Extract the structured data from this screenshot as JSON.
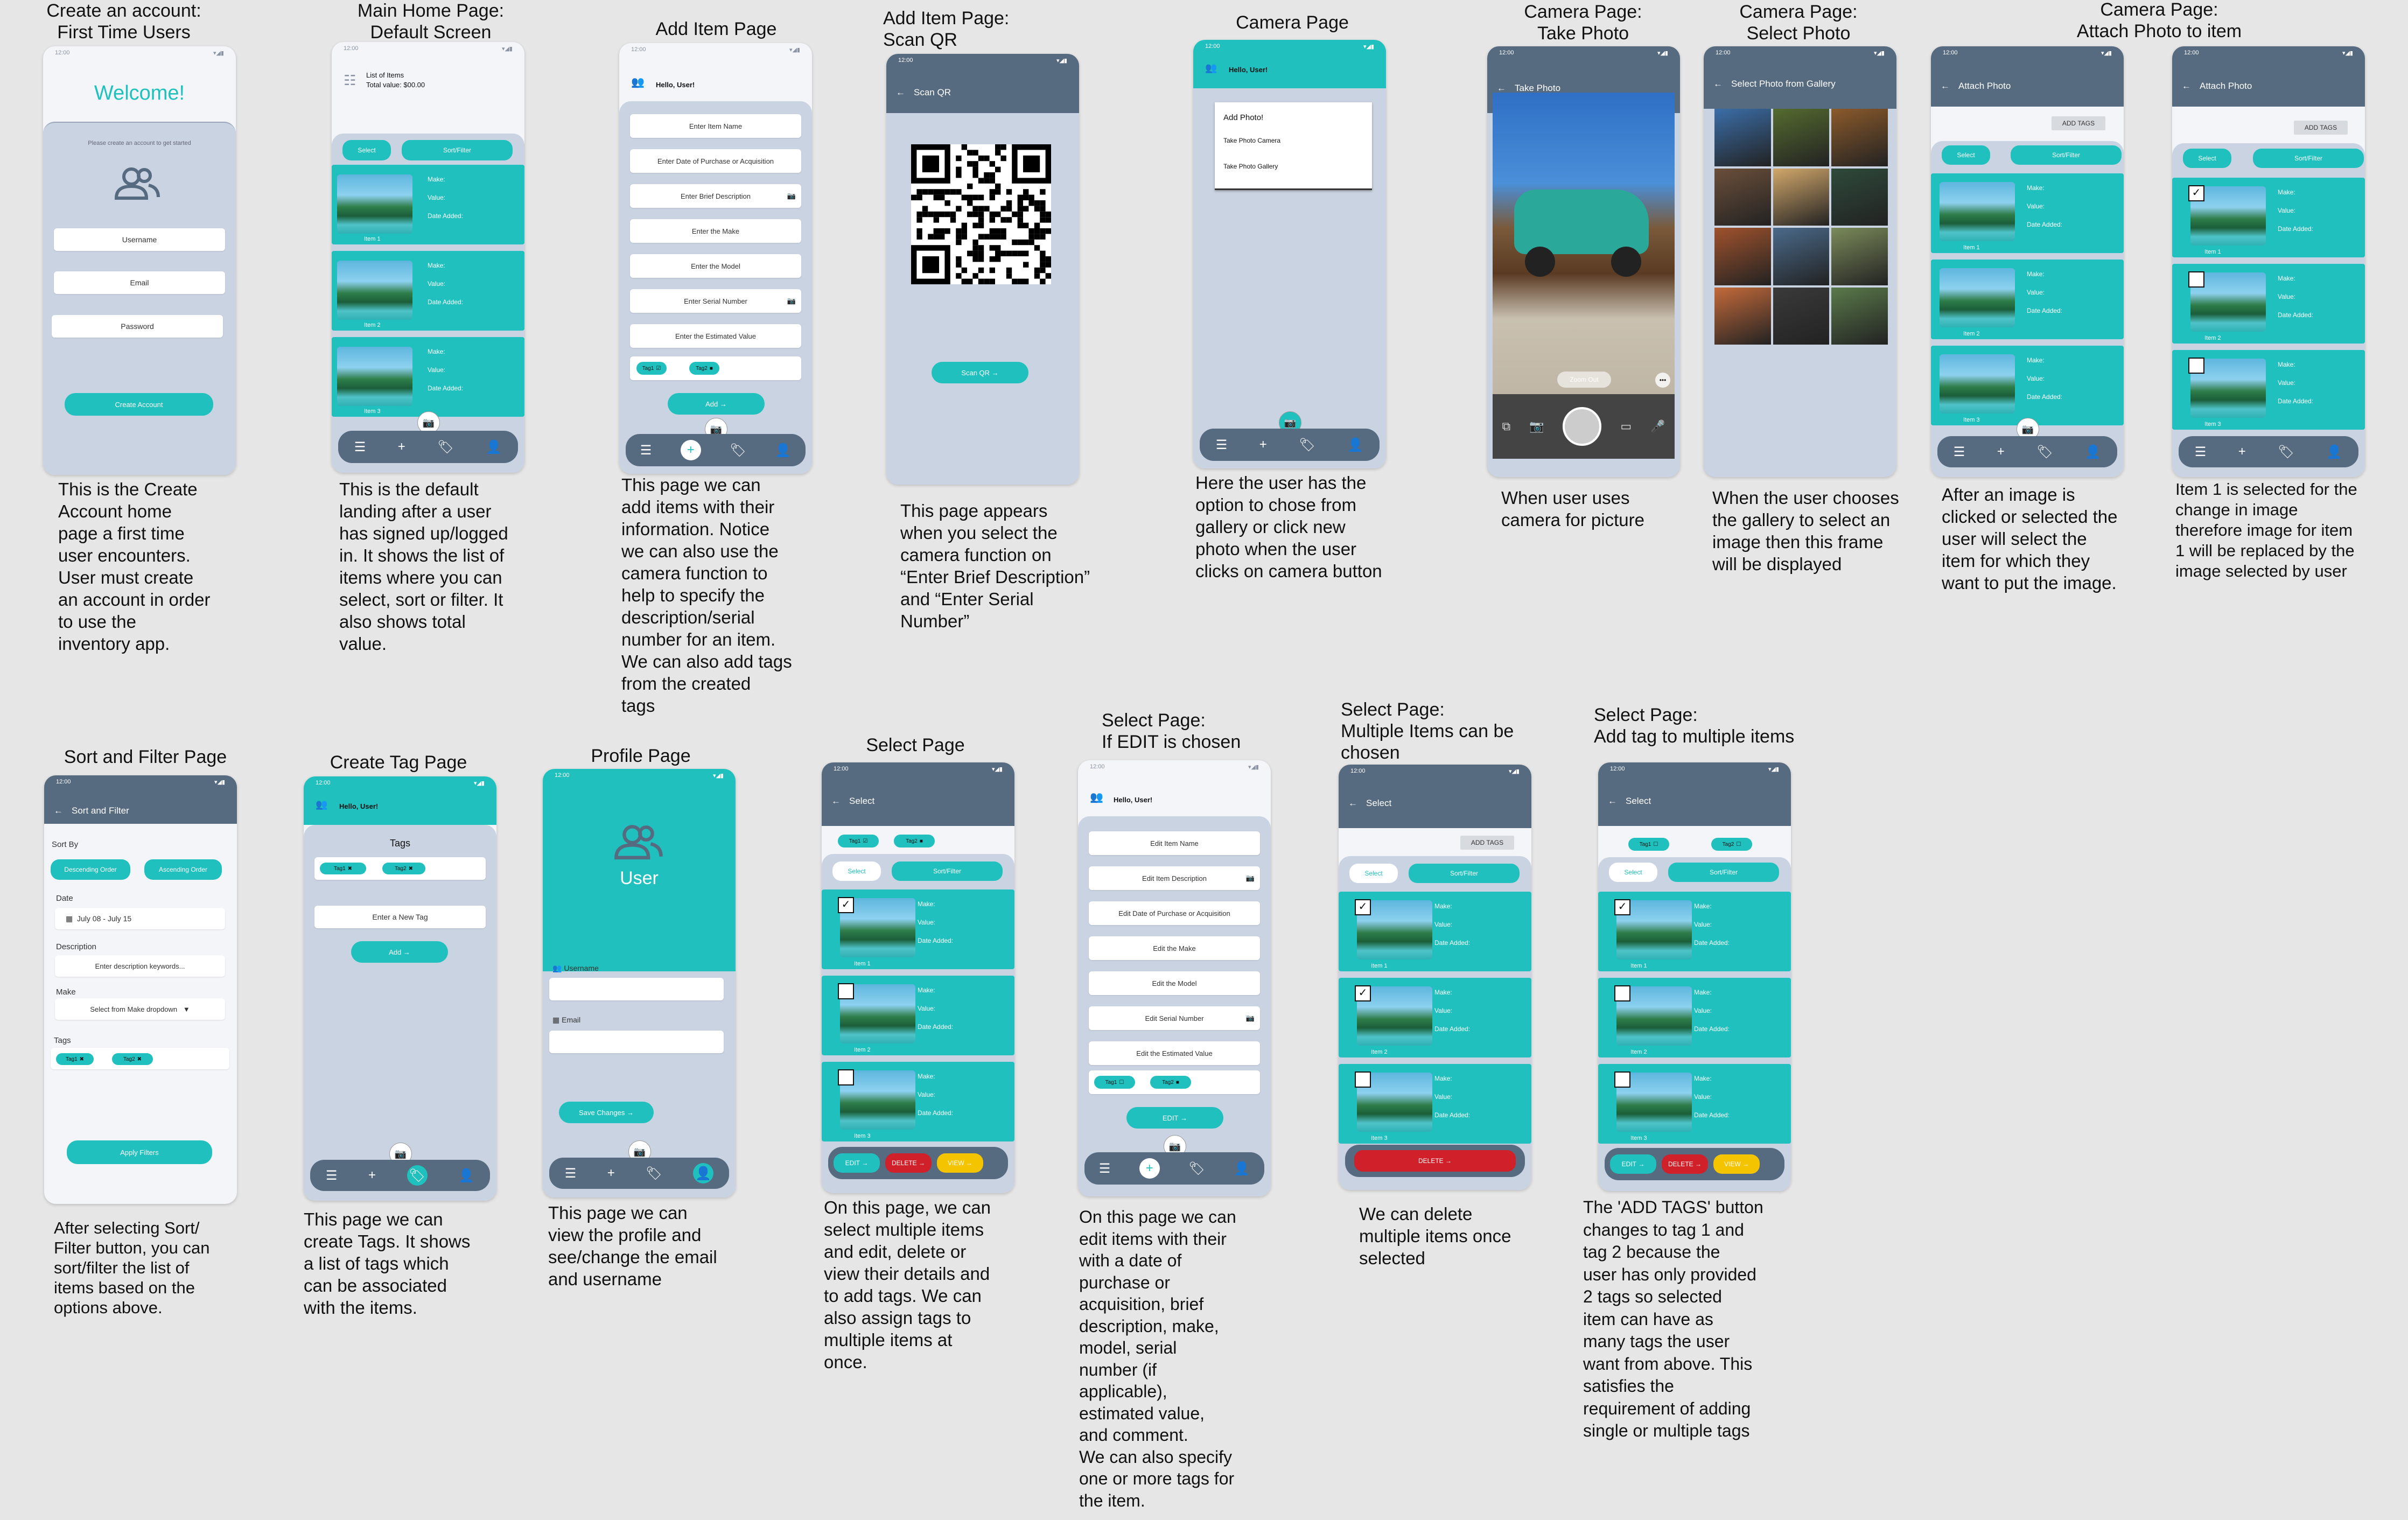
{
  "titles": {
    "t1": "Create an account:\nFirst Time Users",
    "t2": "Main Home Page:\nDefault Screen",
    "t3": "Add Item Page",
    "t4": "Add Item Page:\nScan QR",
    "t5": "Camera Page",
    "t6": "Camera Page:\nTake Photo",
    "t7": "Camera Page:\nSelect Photo",
    "t8": "Camera Page:\nAttach Photo to item",
    "t9": "Sort and Filter Page",
    "t10": "Create Tag Page",
    "t11": "Profile Page",
    "t12": "Select Page",
    "t13": "Select Page:\nIf EDIT is chosen",
    "t14": "Select Page:\nMultiple Items can be\nchosen",
    "t15": "Select Page:\nAdd tag to multiple items"
  },
  "descriptions": {
    "d1": "This is the Create\nAccount home\npage a first time\nuser encounters.\nUser must create\nan account in order\nto use the\ninventory app.",
    "d2": "This is the default\nlanding after a user\nhas signed up/logged\nin. It shows the list of\nitems where you can\nselect, sort or filter. It\nalso shows total\nvalue.",
    "d3": "This page we can\nadd items with their\ninformation. Notice\nwe can also use the\ncamera function to\nhelp to specify the\ndescription/serial\nnumber for an item.\nWe can also add tags\nfrom the created\ntags",
    "d4": "This page appears\nwhen you select the\ncamera function on\n“Enter Brief Description”\nand “Enter Serial\nNumber”",
    "d5": "Here the user has the\noption to chose from\ngallery or click new\nphoto when the user\nclicks on camera button",
    "d6": "When user uses\ncamera for picture",
    "d7": "When the user chooses\nthe gallery to select an\nimage then this frame\nwill be displayed",
    "d8": "After an image is\nclicked or selected the\nuser will select the\nitem for which they\nwant to put the image.",
    "d8b": "Item 1 is selected for the\nchange in image\ntherefore image for item\n1 will be replaced by the\nimage selected by user",
    "d9": "After selecting Sort/\nFilter button, you can\nsort/filter the list of\nitems based on the\noptions above.",
    "d10": "This page we can\ncreate Tags. It shows\na list of tags which\ncan be associated\nwith the items.",
    "d11": "This page we can\nview the profile and\nsee/change the email\nand username",
    "d12": "On this page, we can\nselect multiple items\nand edit, delete or\nview their details and\nto add tags. We can\nalso assign tags to\nmultiple items at\nonce.",
    "d13": "On this page we can\nedit items with their\nwith a date of\npurchase or\nacquisition, brief\ndescription, make,\nmodel, serial\nnumber (if\napplicable),\nestimated value,\nand comment.\nWe can also specify\none or more tags for\nthe item.",
    "d14": "We can delete\nmultiple items once\nselected",
    "d15": "The 'ADD TAGS' button\nchanges to tag 1 and\ntag 2  because the\nuser has only provided\n2 tags so selected\nitem can have as\nmany tags the user\nwant from above. This\nsatisfies the\nrequirement of adding\nsingle or multiple tags"
  },
  "common": {
    "time": "12:00",
    "hello": "Hello, User!",
    "make": "Make:",
    "value": "Value:",
    "date_added": "Date Added:",
    "item1": "Item 1",
    "item2": "Item 2",
    "item3": "Item 3",
    "select": "Select",
    "sort_filter": "Sort/Filter",
    "tag1": "Tag1",
    "tag2": "Tag2",
    "add": "Add",
    "add_tags": "ADD TAGS",
    "edit": "EDIT",
    "delete": "DELETE",
    "view": "VIEW"
  },
  "create_account": {
    "welcome": "Welcome!",
    "prompt": "Please create an account to get started",
    "username": "Username",
    "email": "Email",
    "password": "Password",
    "button": "Create Account"
  },
  "home": {
    "list_title": "List of Items",
    "total": "Total value: $00.00"
  },
  "add_item": {
    "fields": [
      "Enter Item Name",
      "Enter Date of Purchase or Acquisition",
      "Enter Brief Description",
      "Enter the Make",
      "Enter the Model",
      "Enter Serial Number",
      "Enter the Estimated Value"
    ]
  },
  "scan": {
    "header": "Scan QR",
    "button": "Scan QR"
  },
  "camera": {
    "menu_title": "Add Photo!",
    "opt1": "Take Photo Camera",
    "opt2": "Take Photo Gallery"
  },
  "take_photo": {
    "header": "Take Photo",
    "zoom": "Zoom Out"
  },
  "gallery": {
    "header": "Select Photo from Gallery"
  },
  "attach": {
    "header": "Attach Photo"
  },
  "sort_filter": {
    "header": "Sort and Filter",
    "sort_by": "Sort By",
    "desc": "Descending Order",
    "asc": "Ascending Order",
    "date": "Date",
    "date_range": "July 08 - July 15",
    "description": "Description",
    "desc_placeholder": "Enter description keywords...",
    "make": "Make",
    "make_placeholder": "Select from Make dropdown",
    "tags": "Tags",
    "apply": "Apply Filters"
  },
  "create_tag": {
    "tags": "Tags",
    "new_tag": "Enter a New Tag"
  },
  "profile": {
    "user": "User",
    "username": "Username",
    "email": "Email",
    "save": "Save Changes"
  },
  "edit": {
    "fields": [
      "Edit Item Name",
      "Edit Item Description",
      "Edit Date of Purchase or Acquisition",
      "Edit the Make",
      "Edit the Model",
      "Edit Serial Number",
      "Edit the Estimated Value"
    ]
  },
  "colors": {
    "teal": "#1fc0bd",
    "slate": "#566a80",
    "panel": "#c9d3e1",
    "delete_red": "#d0202a",
    "view_yellow": "#f5c400"
  }
}
